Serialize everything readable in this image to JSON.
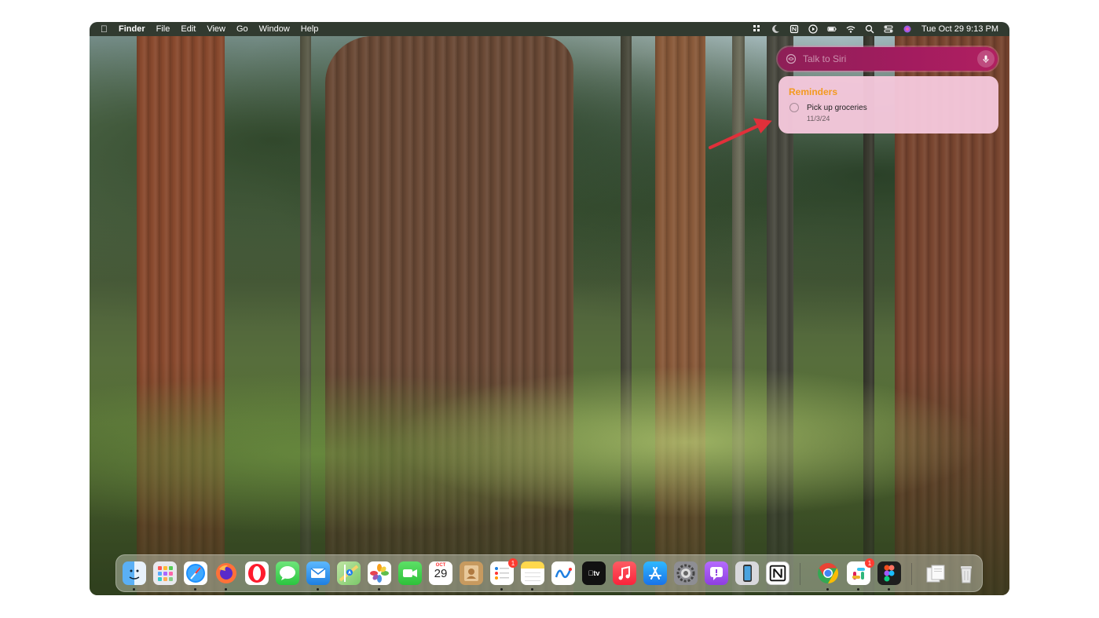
{
  "menubar": {
    "app_name": "Finder",
    "menus": [
      "File",
      "Edit",
      "View",
      "Go",
      "Window",
      "Help"
    ],
    "clock": "Tue Oct 29  9:13 PM"
  },
  "siri": {
    "placeholder": "Talk to Siri"
  },
  "reminders": {
    "title": "Reminders",
    "item": "Pick up groceries",
    "date": "11/3/24"
  },
  "dock": {
    "calendar_month": "OCT",
    "calendar_day": "29",
    "reminders_badge": "1",
    "slack_badge": "1"
  },
  "colors": {
    "siri_bar": "#a31c5f",
    "reminders_panel": "#f5c8dc",
    "reminders_title": "#f39a1f",
    "annotation_arrow": "#e0303a"
  }
}
